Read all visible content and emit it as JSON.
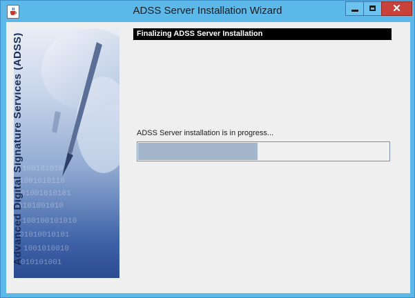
{
  "window": {
    "title": "ADSS Server Installation Wizard",
    "close_glyph": "✕"
  },
  "side_panel": {
    "text": "Advanced Digital Signature Services (ADSS)"
  },
  "step_header": "Finalizing ADSS Server Installation",
  "progress": {
    "label": "ADSS Server installation is in progress...",
    "fraction": 0.48
  },
  "icons": [
    "java-cup-icon",
    "minimize-icon",
    "maximize-icon",
    "close-icon",
    "pen-artwork"
  ],
  "colors": {
    "frame": "#5cb8e8",
    "close_button": "#c8413b",
    "header_band": "#000000",
    "progress_fill": "#a4b6cc"
  }
}
